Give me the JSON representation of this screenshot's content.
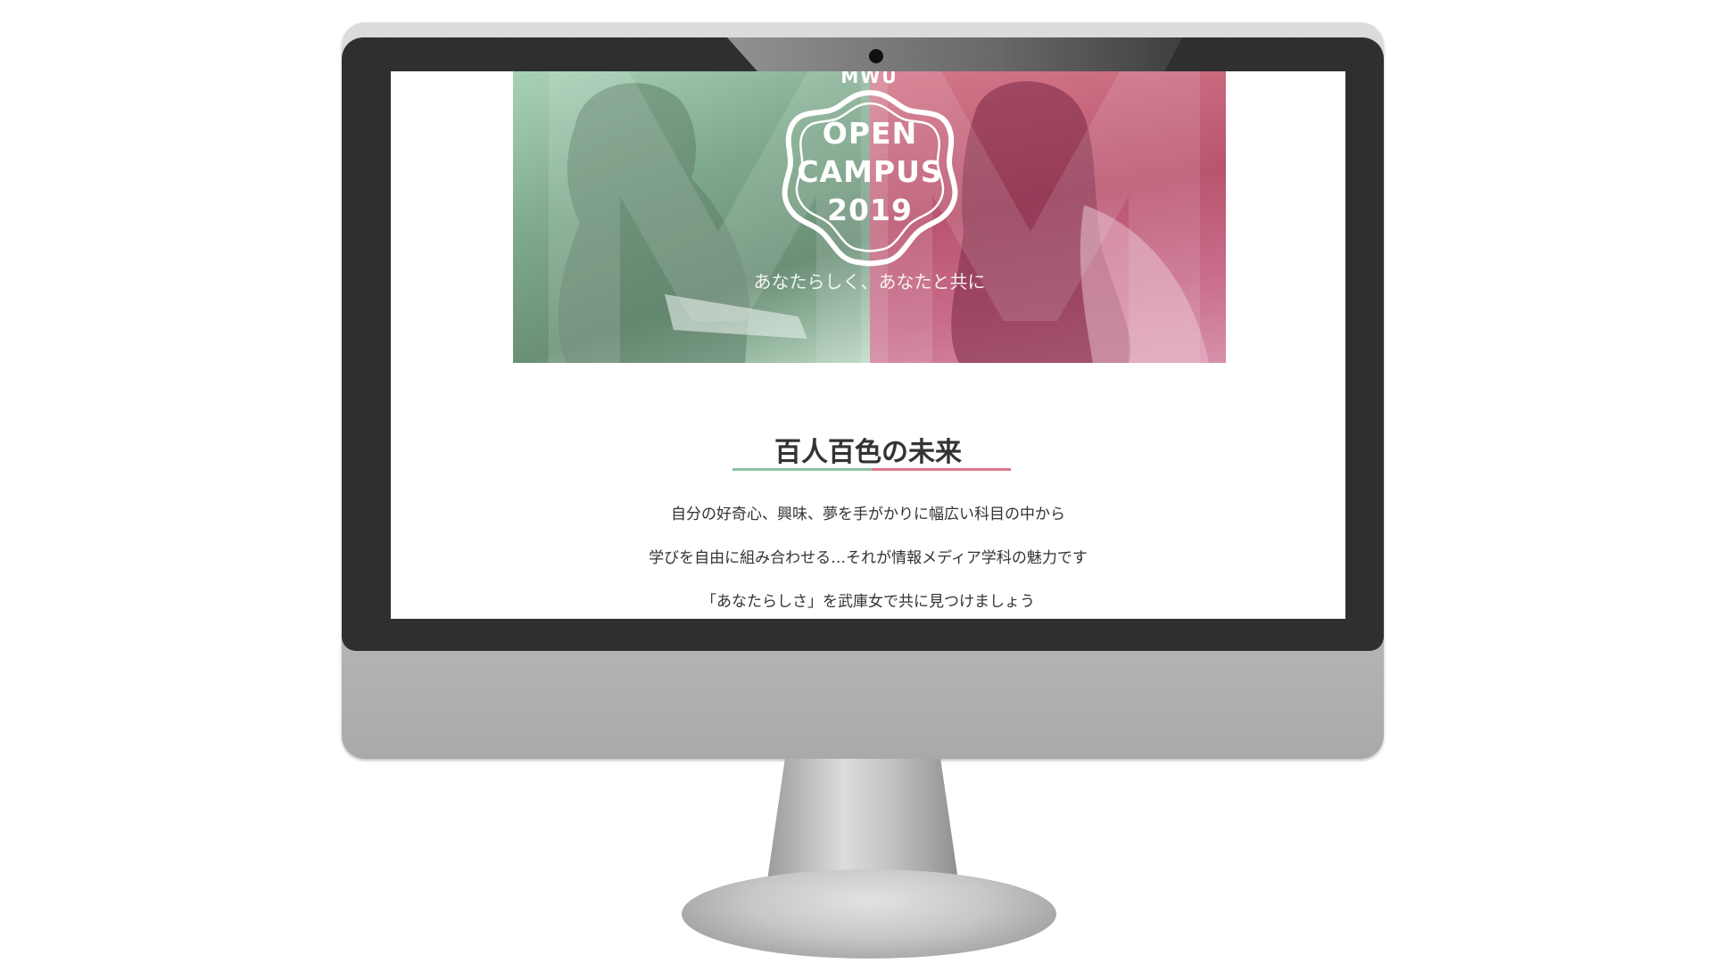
{
  "hero": {
    "brand": "MWU",
    "badge_lines": [
      "OPEN",
      "CAMPUS",
      "2019"
    ],
    "tagline": "あなたらしく、あなたと共に"
  },
  "intro": {
    "title": "百人百色の未来",
    "lines": [
      "自分の好奇心、興味、夢を手がかりに幅広い科目の中から",
      "学びを自由に組み合わせる…それが情報メディア学科の魅力です",
      "「あなたらしさ」を武庫女で共に見つけましょう"
    ]
  },
  "colors": {
    "accent_green": "#8cc4a3",
    "accent_pink": "#e0768f",
    "text": "#333333",
    "bezel": "#2f2f2f"
  }
}
